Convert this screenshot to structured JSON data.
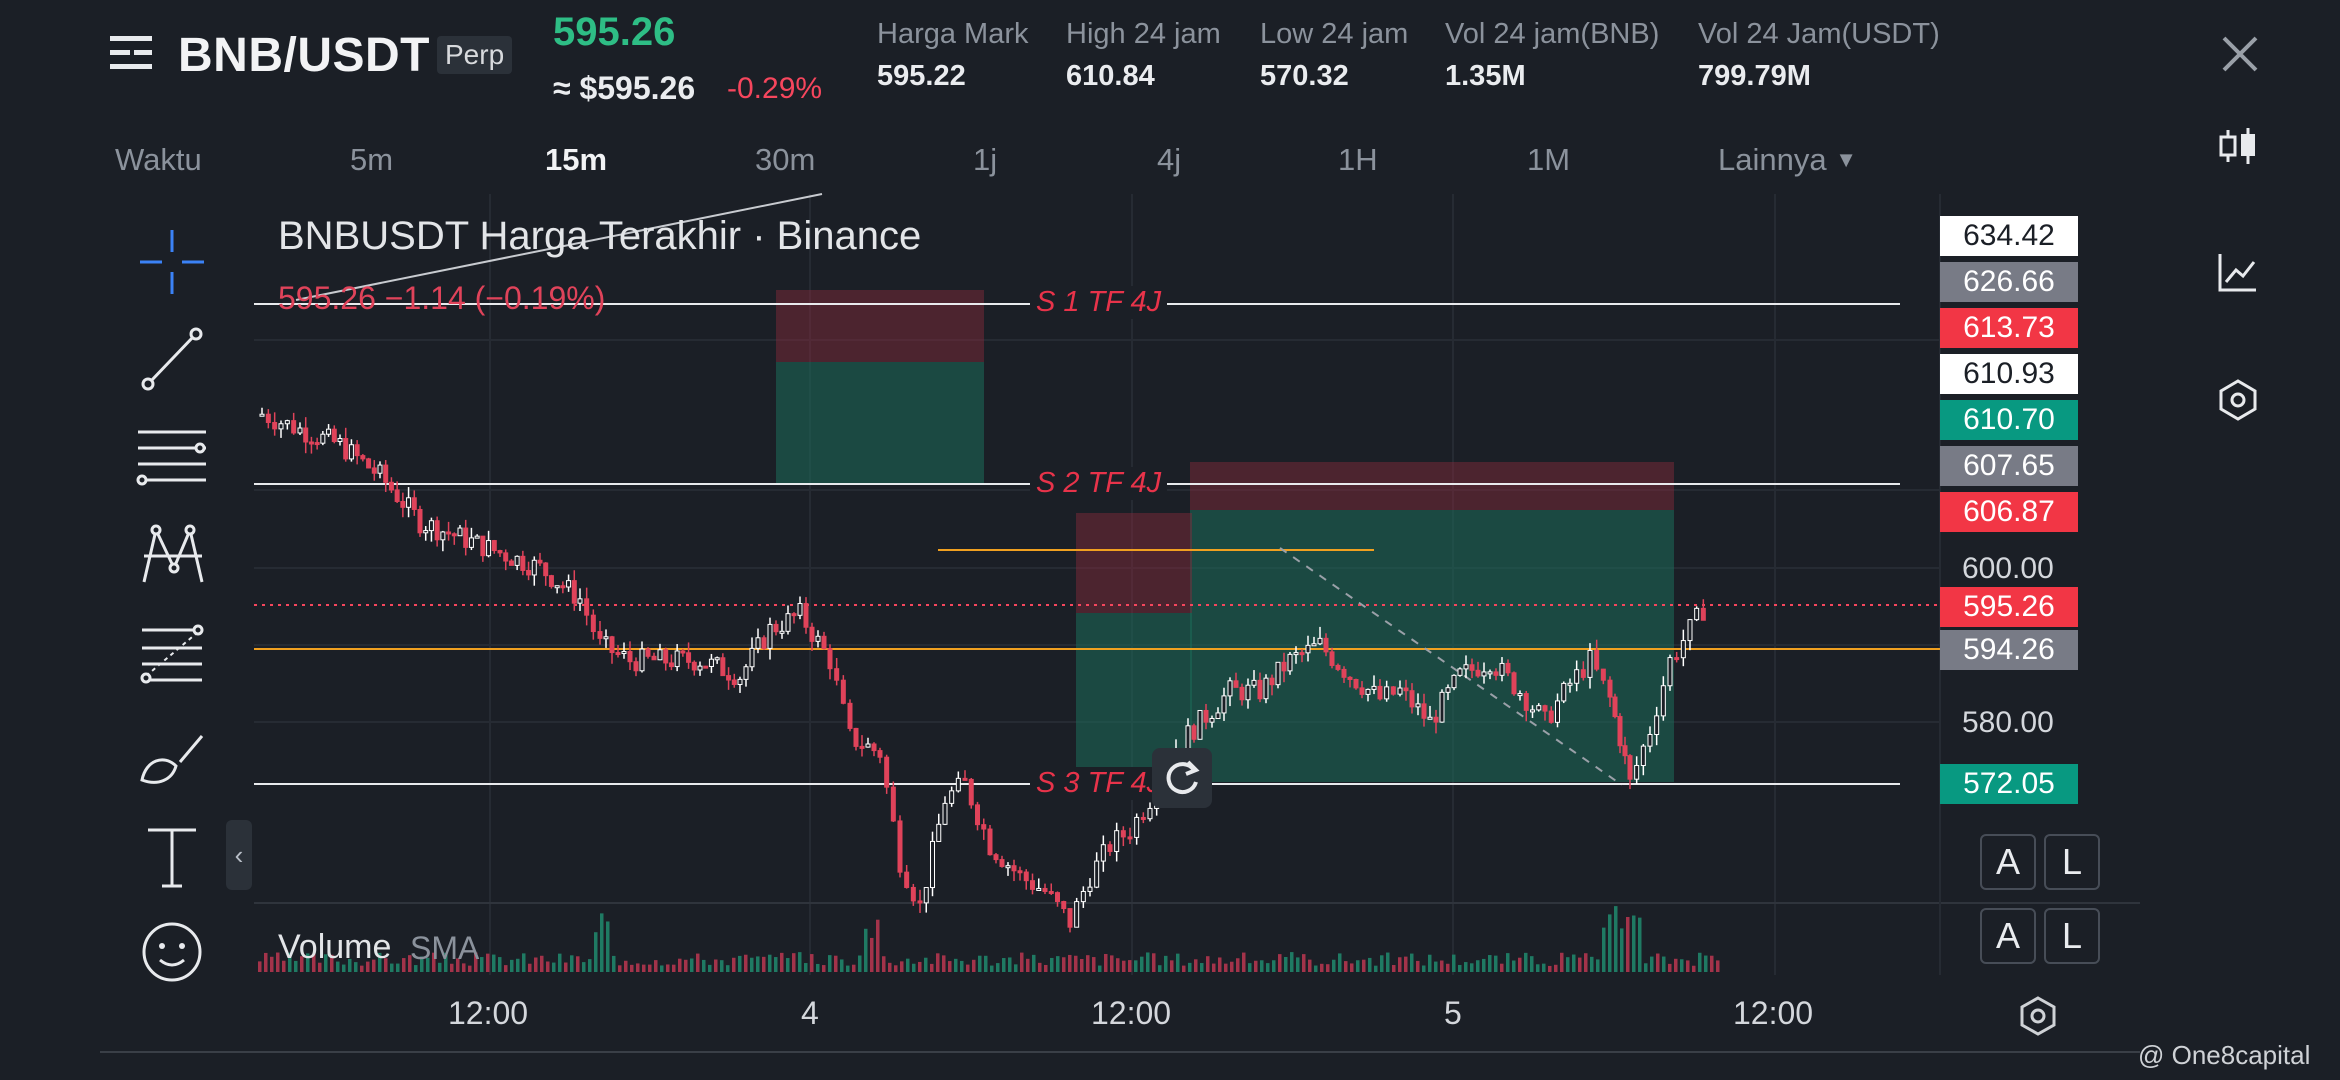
{
  "header": {
    "pair": "BNB/USDT",
    "contract_type": "Perp",
    "last_price": "595.26",
    "usd_equivalent": "≈ $595.26",
    "change_pct": "-0.29%",
    "stats": [
      {
        "label": "Harga Mark",
        "value": "595.22"
      },
      {
        "label": "High 24 jam",
        "value": "610.84"
      },
      {
        "label": "Low 24 jam",
        "value": "570.32"
      },
      {
        "label": "Vol 24 jam(BNB)",
        "value": "1.35M"
      },
      {
        "label": "Vol 24 Jam(USDT)",
        "value": "799.79M"
      }
    ]
  },
  "timeframes": {
    "label": "Waktu",
    "items": [
      "5m",
      "15m",
      "30m",
      "1j",
      "4j",
      "1H",
      "1M"
    ],
    "active": "15m",
    "more": "Lainnya"
  },
  "chart": {
    "title": "BNBUSDT Harga Terakhir · Binance",
    "ohlc": "595.26 −1.14 (−0.19%)",
    "volume_label": "Volume",
    "sma_label": "SMA",
    "x_labels": [
      "12:00",
      "4",
      "12:00",
      "5",
      "12:00"
    ],
    "y_labels": [
      "600.00",
      "580.00"
    ],
    "level_labels": [
      "S 1 TF 4J",
      "S 2 TF 4J",
      "S 3 TF 4J"
    ],
    "price_tags": [
      {
        "value": "634.42",
        "bg": "#ffffff",
        "fg": "#1b1f26"
      },
      {
        "value": "626.66",
        "bg": "#787b86",
        "fg": "#ffffff"
      },
      {
        "value": "613.73",
        "bg": "#f23645",
        "fg": "#ffffff"
      },
      {
        "value": "610.93",
        "bg": "#ffffff",
        "fg": "#1b1f26"
      },
      {
        "value": "610.70",
        "bg": "#089981",
        "fg": "#ffffff"
      },
      {
        "value": "607.65",
        "bg": "#787b86",
        "fg": "#ffffff"
      },
      {
        "value": "606.87",
        "bg": "#f23645",
        "fg": "#ffffff"
      },
      {
        "value": "595.26",
        "bg": "#f23645",
        "fg": "#ffffff"
      },
      {
        "value": "594.26",
        "bg": "#787b86",
        "fg": "#ffffff"
      },
      {
        "value": "572.05",
        "bg": "#089981",
        "fg": "#ffffff"
      }
    ],
    "alert_buttons": [
      "A",
      "L",
      "A",
      "L"
    ]
  },
  "watermark": "@ One8capital",
  "colors": {
    "up": "#2ebd85",
    "down": "#f6465d",
    "candle_up": "#ffffff",
    "candle_down": "#e0435a",
    "orange": "#f0a020"
  },
  "icons": {
    "menu": "menu-icon",
    "close": "close-icon",
    "chart_type": "candlestick-icon",
    "indicators": "indicator-icon",
    "settings": "hexagon-settings-icon"
  }
}
